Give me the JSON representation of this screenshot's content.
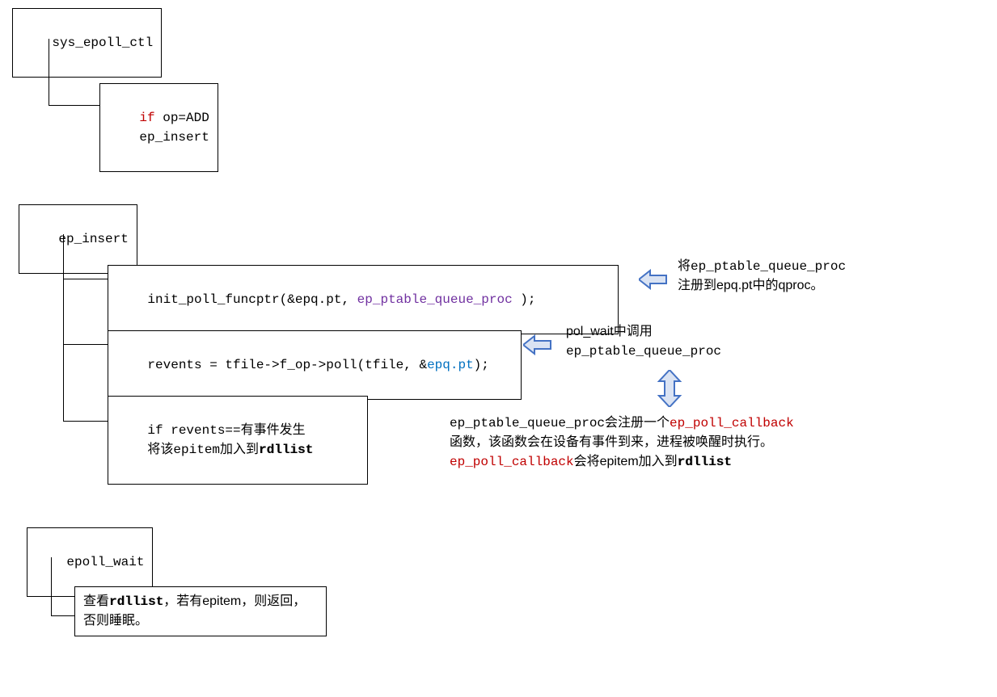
{
  "box1": {
    "text": "sys_epoll_ctl"
  },
  "box2": {
    "line1_kw": "if",
    "line1_rest": " op=ADD",
    "line2": "    ep_insert"
  },
  "box3": {
    "text": "ep_insert"
  },
  "box4": {
    "pre": "init_poll_funcptr(&epq.pt, ",
    "purple": "ep_ptable_queue_proc",
    "post": " );"
  },
  "box5": {
    "pre": "revents = tfile->f_op->poll(tfile, &",
    "blue": "epq.pt",
    "post": ");"
  },
  "box6": {
    "line1": "if revents==有事件发生",
    "line2_pre": "    将该epitem加入到",
    "line2_bold": "rdllist"
  },
  "box7": {
    "text": "epoll_wait"
  },
  "box8": {
    "pre": "查看",
    "bold": "rdllist",
    "post": "，若有epitem，则返回，否则睡眠。"
  },
  "anno1": {
    "line1_pre": "将",
    "line1_mono": "ep_ptable_queue_proc",
    "line2": "注册到epq.pt中的qproc。"
  },
  "anno2": {
    "line1": "pol_wait中调用",
    "line2": "ep_ptable_queue_proc"
  },
  "anno3": {
    "l1_pre": "ep_ptable_queue_proc会注册一个",
    "l1_red": "ep_poll_callback",
    "l2": "函数，该函数会在设备有事件到来，进程被唤醒时执行。",
    "l3_red": "ep_poll_callback",
    "l3_mid": "会将epitem加入到",
    "l3_bold": "rdllist"
  }
}
